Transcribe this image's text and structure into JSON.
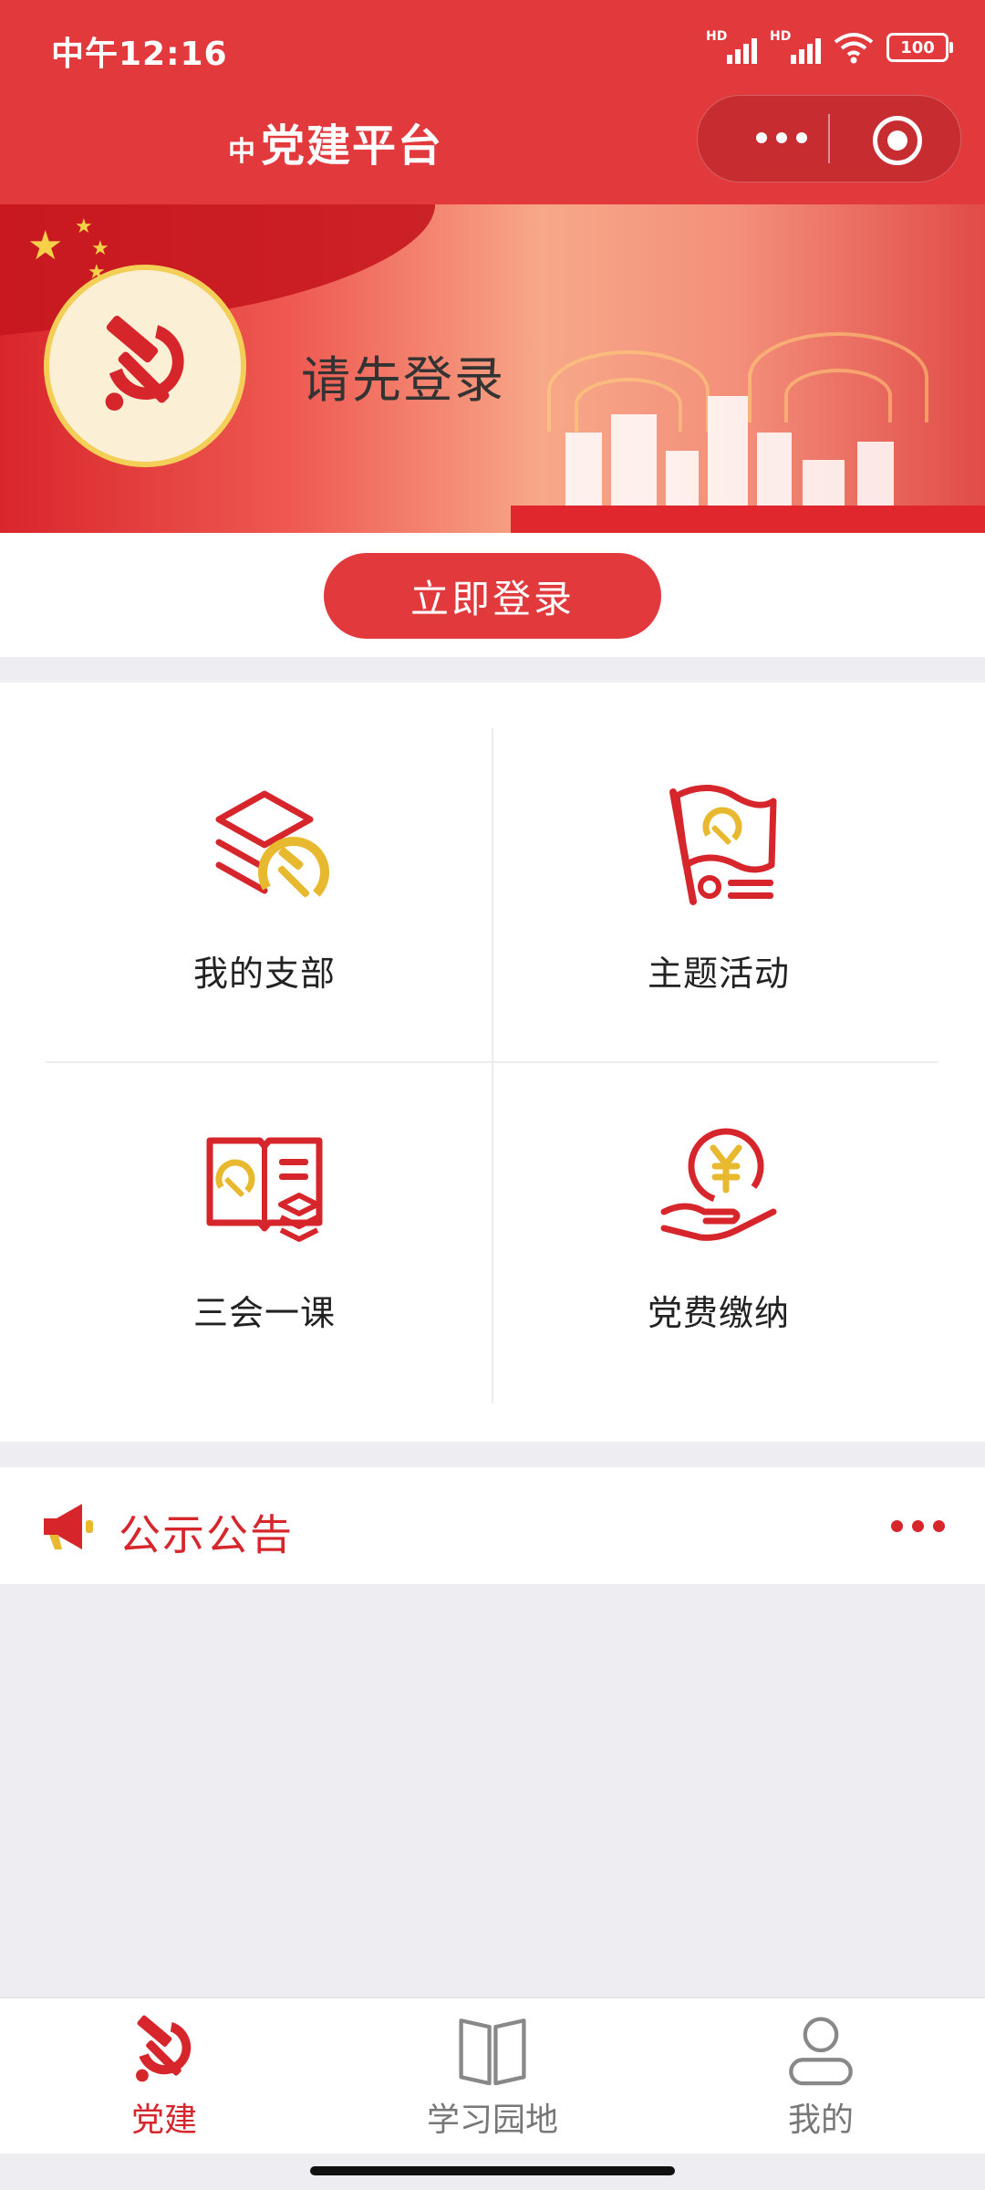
{
  "status_bar": {
    "time": "中午12:16",
    "hd1": "HD",
    "hd2": "HD",
    "battery": "100"
  },
  "nav": {
    "title_small": "中",
    "title": "党建平台"
  },
  "banner": {
    "login_prompt": "请先登录"
  },
  "login": {
    "button_label": "立即登录"
  },
  "grid": {
    "items": [
      {
        "label": "我的支部",
        "icon": "branch-icon"
      },
      {
        "label": "主题活动",
        "icon": "flag-icon"
      },
      {
        "label": "三会一课",
        "icon": "book-icon"
      },
      {
        "label": "党费缴纳",
        "icon": "yuan-hand-icon"
      }
    ]
  },
  "notice": {
    "title": "公示公告"
  },
  "tabbar": {
    "tabs": [
      {
        "label": "党建",
        "icon": "party-emblem-icon",
        "active": true
      },
      {
        "label": "学习园地",
        "icon": "open-book-icon",
        "active": false
      },
      {
        "label": "我的",
        "icon": "user-icon",
        "active": false
      }
    ]
  },
  "colors": {
    "primary": "#e2393d",
    "accent_red": "#d7262b",
    "gold": "#e8b92e",
    "background": "#eeeef2"
  }
}
